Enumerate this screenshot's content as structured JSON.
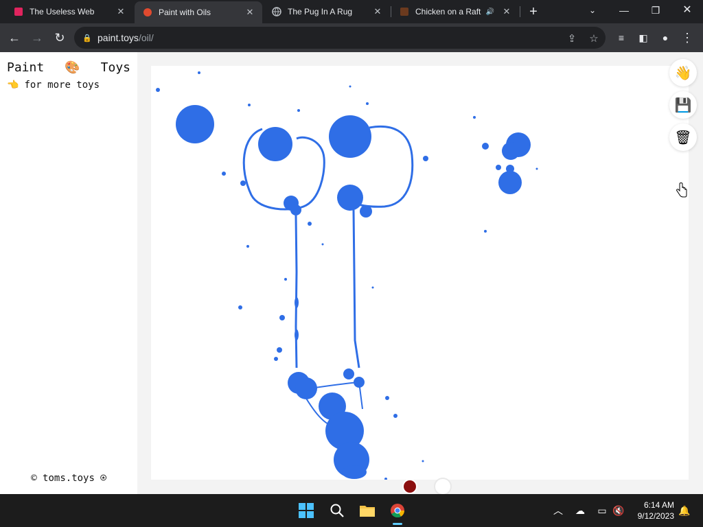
{
  "tabs": [
    {
      "title": "The Useless Web",
      "favicon": "useless-web-favicon",
      "active": false
    },
    {
      "title": "Paint with Oils",
      "favicon": "tomato-favicon",
      "active": true
    },
    {
      "title": "The Pug In A Rug",
      "favicon": "globe-icon",
      "active": false
    },
    {
      "title": "Chicken on a Raft",
      "favicon": "chicken-favicon",
      "active": false,
      "audio": true
    }
  ],
  "address": {
    "host": "paint.toys",
    "path": "/oil/"
  },
  "sidebar": {
    "brand": [
      "Paint",
      "🎨",
      "Toys"
    ],
    "more_link": "for more toys",
    "more_icon": "👈",
    "credit": "© toms.toys ⍟"
  },
  "tools": [
    {
      "name": "wave-hand-icon",
      "glyph": "👋"
    },
    {
      "name": "save-icon",
      "glyph": "💾"
    },
    {
      "name": "trash-icon",
      "glyph": "🗑"
    }
  ],
  "colors": {
    "paint": "#2f6ee6",
    "swatch_red": "#8b0f0f",
    "swatch_white": "#ffffff",
    "chrome_dark": "#202124",
    "chrome_mid": "#35363a"
  },
  "taskbar": {
    "time": "6:14 AM",
    "date": "9/12/2023"
  }
}
